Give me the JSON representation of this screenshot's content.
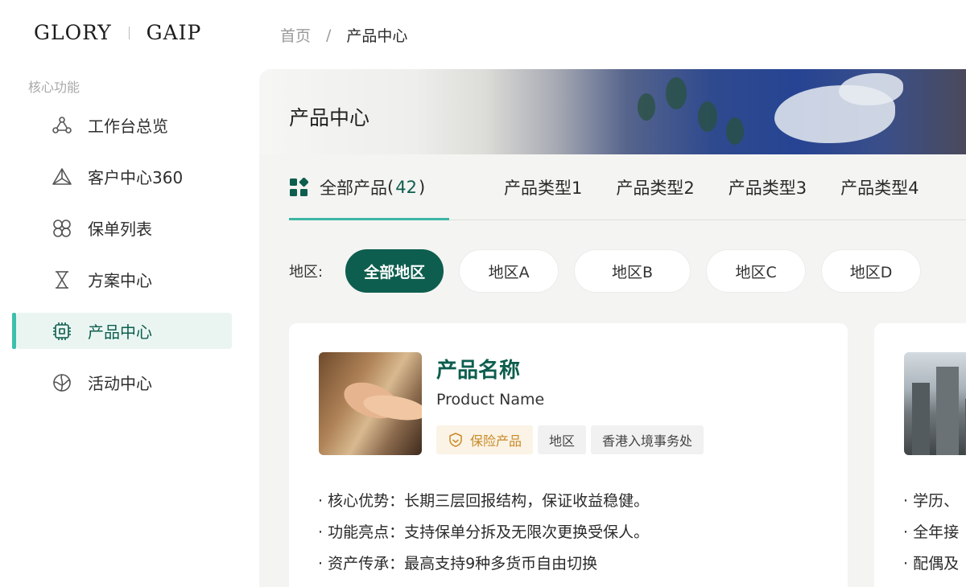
{
  "header": {
    "logo_left": "GLORY",
    "logo_right": "GAIP",
    "breadcrumb": {
      "home": "首页",
      "separator": "/",
      "current": "产品中心"
    }
  },
  "sidebar": {
    "section_title": "核心功能",
    "items": [
      {
        "label": "工作台总览",
        "icon": "workflow-icon",
        "active": false
      },
      {
        "label": "客户中心360",
        "icon": "triangle-network-icon",
        "active": false
      },
      {
        "label": "保单列表",
        "icon": "knot-icon",
        "active": false
      },
      {
        "label": "方案中心",
        "icon": "hourglass-icon",
        "active": false
      },
      {
        "label": "产品中心",
        "icon": "chip-icon",
        "active": true
      },
      {
        "label": "活动中心",
        "icon": "activity-circle-icon",
        "active": false
      }
    ]
  },
  "main": {
    "banner_title": "产品中心",
    "tabs": {
      "all": {
        "label": "全部产品",
        "open": "(",
        "count": "42",
        "close": ")"
      },
      "types": [
        "产品类型1",
        "产品类型2",
        "产品类型3",
        "产品类型4"
      ]
    },
    "region": {
      "label": "地区:",
      "options": [
        "全部地区",
        "地区A",
        "地区B",
        "地区C",
        "地区D"
      ],
      "selected": "全部地区"
    },
    "cards": [
      {
        "name": "产品名称",
        "name_en": "Product Name",
        "tags": [
          "保险产品",
          "地区",
          "香港入境事务处"
        ],
        "features": [
          "· 核心优势：长期三层回报结构，保证收益稳健。",
          "· 功能亮点：支持保单分拆及无限次更换受保人。",
          "· 资产传承：最高支持9种多货币自由切换"
        ]
      },
      {
        "features": [
          "· 学历、",
          "· 全年接",
          "· 配偶及"
        ]
      }
    ]
  },
  "colors": {
    "brand_green": "#0d5e4e",
    "accent_teal": "#3cc0ad",
    "active_bg": "#eaf5f2",
    "insurance_tag_text": "#c98a25",
    "insurance_tag_bg": "#fbf3e6"
  }
}
